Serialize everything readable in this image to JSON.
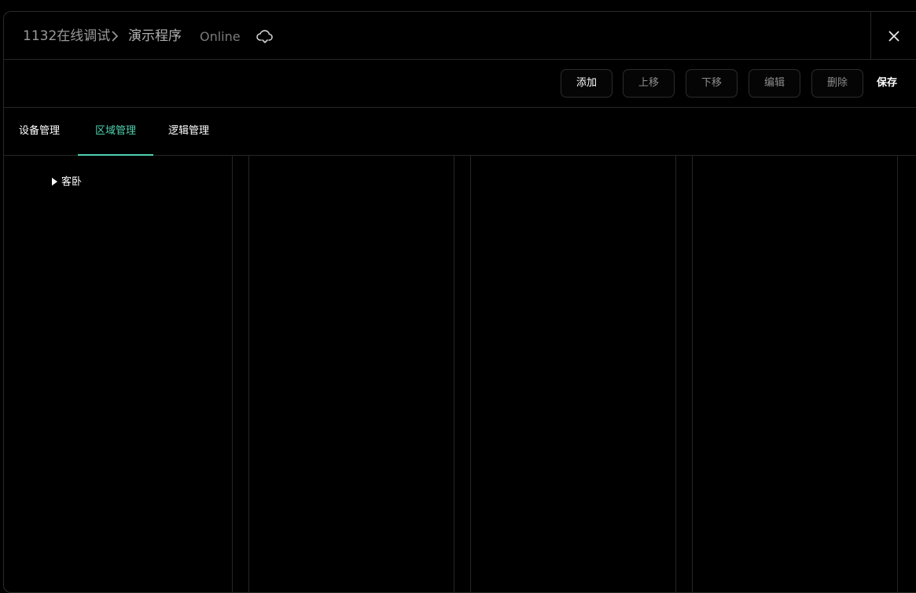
{
  "header": {
    "project": "1132在线调试",
    "page": "演示程序",
    "status": "Online"
  },
  "toolbar": {
    "add_label": "添加",
    "move_up_label": "上移",
    "move_down_label": "下移",
    "edit_label": "编辑",
    "delete_label": "删除",
    "save_label": "保存"
  },
  "tabs": [
    {
      "label": "设备管理",
      "active": false
    },
    {
      "label": "区域管理",
      "active": true
    },
    {
      "label": "逻辑管理",
      "active": false
    }
  ],
  "tree": {
    "nodes": [
      {
        "label": "客卧",
        "expanded": false
      }
    ]
  },
  "colors": {
    "accent": "#4fd1ae",
    "background": "#000000",
    "border": "#262626",
    "muted_text": "#8c8c8c"
  },
  "icons": {
    "breadcrumb_separator": "chevron-right-icon",
    "sync": "cloud-sync-icon",
    "close": "close-icon",
    "tree_toggle": "caret-right-icon"
  }
}
